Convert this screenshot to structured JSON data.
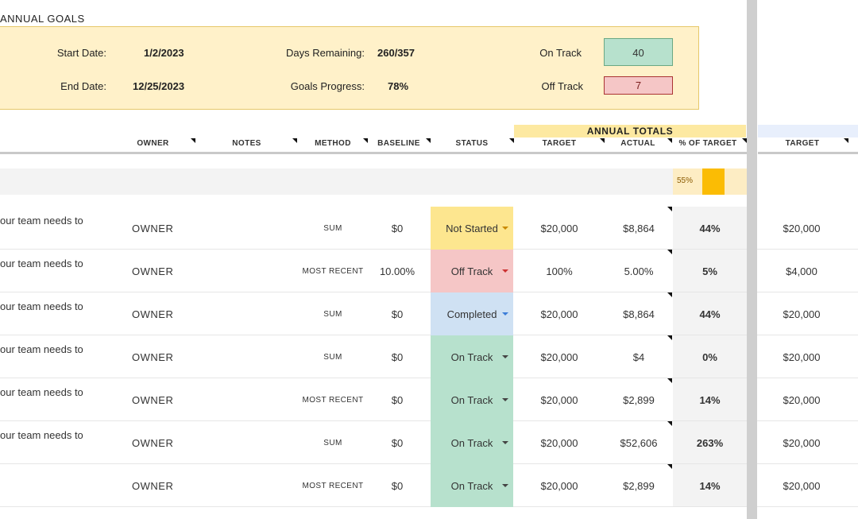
{
  "section_title": "ANNUAL GOALS",
  "summary": {
    "start_label": "Start Date:",
    "start_value": "1/2/2023",
    "end_label": "End Date:",
    "end_value": "12/25/2023",
    "days_label": "Days Remaining:",
    "days_value": "260/357",
    "progress_label": "Goals Progress:",
    "progress_value": "78%",
    "on_track_label": "On Track",
    "on_track_value": "40",
    "off_track_label": "Off Track",
    "off_track_value": "7"
  },
  "annual_totals_title": "ANNUAL TOTALS",
  "columns": {
    "owner": "OWNER",
    "notes": "NOTES",
    "method": "METHOD",
    "baseline": "BASELINE",
    "status": "STATUS",
    "target": "TARGET",
    "actual": "ACTUAL",
    "pct_of_target": "% OF TARGET",
    "target_right": "TARGET"
  },
  "subtotal": {
    "pct_label": "55%",
    "pct_value": 0.55
  },
  "colors": {
    "not_started": "#fde68f",
    "off_track": "#f5c6c6",
    "completed": "#cfe1f3",
    "on_track": "#b7e1cd",
    "caret_not_started": "#c98a00",
    "caret_off_track": "#cc3333",
    "caret_completed": "#3b7dd8",
    "caret_on_track": "#444444"
  },
  "rows": [
    {
      "goal": "our team needs to",
      "owner": "OWNER",
      "method": "SUM",
      "baseline": "$0",
      "status": "Not Started",
      "status_key": "not_started",
      "target": "$20,000",
      "actual": "$8,864",
      "pct": "44%",
      "target_right": "$20,000"
    },
    {
      "goal": "our team needs to",
      "owner": "OWNER",
      "method": "MOST RECENT",
      "baseline": "10.00%",
      "status": "Off Track",
      "status_key": "off_track",
      "target": "100%",
      "actual": "5.00%",
      "pct": "5%",
      "target_right": "$4,000"
    },
    {
      "goal": "our team needs to",
      "owner": "OWNER",
      "method": "SUM",
      "baseline": "$0",
      "status": "Completed",
      "status_key": "completed",
      "target": "$20,000",
      "actual": "$8,864",
      "pct": "44%",
      "target_right": "$20,000"
    },
    {
      "goal": "our team needs to",
      "owner": "OWNER",
      "method": "SUM",
      "baseline": "$0",
      "status": "On Track",
      "status_key": "on_track",
      "target": "$20,000",
      "actual": "$4",
      "pct": "0%",
      "target_right": "$20,000"
    },
    {
      "goal": "our team needs to",
      "owner": "OWNER",
      "method": "MOST RECENT",
      "baseline": "$0",
      "status": "On Track",
      "status_key": "on_track",
      "target": "$20,000",
      "actual": "$2,899",
      "pct": "14%",
      "target_right": "$20,000"
    },
    {
      "goal": "our team needs to",
      "owner": "OWNER",
      "method": "SUM",
      "baseline": "$0",
      "status": "On Track",
      "status_key": "on_track",
      "target": "$20,000",
      "actual": "$52,606",
      "pct": "263%",
      "target_right": "$20,000"
    },
    {
      "goal": "",
      "owner": "OWNER",
      "method": "MOST RECENT",
      "baseline": "$0",
      "status": "On Track",
      "status_key": "on_track",
      "target": "$20,000",
      "actual": "$2,899",
      "pct": "14%",
      "target_right": "$20,000"
    }
  ]
}
